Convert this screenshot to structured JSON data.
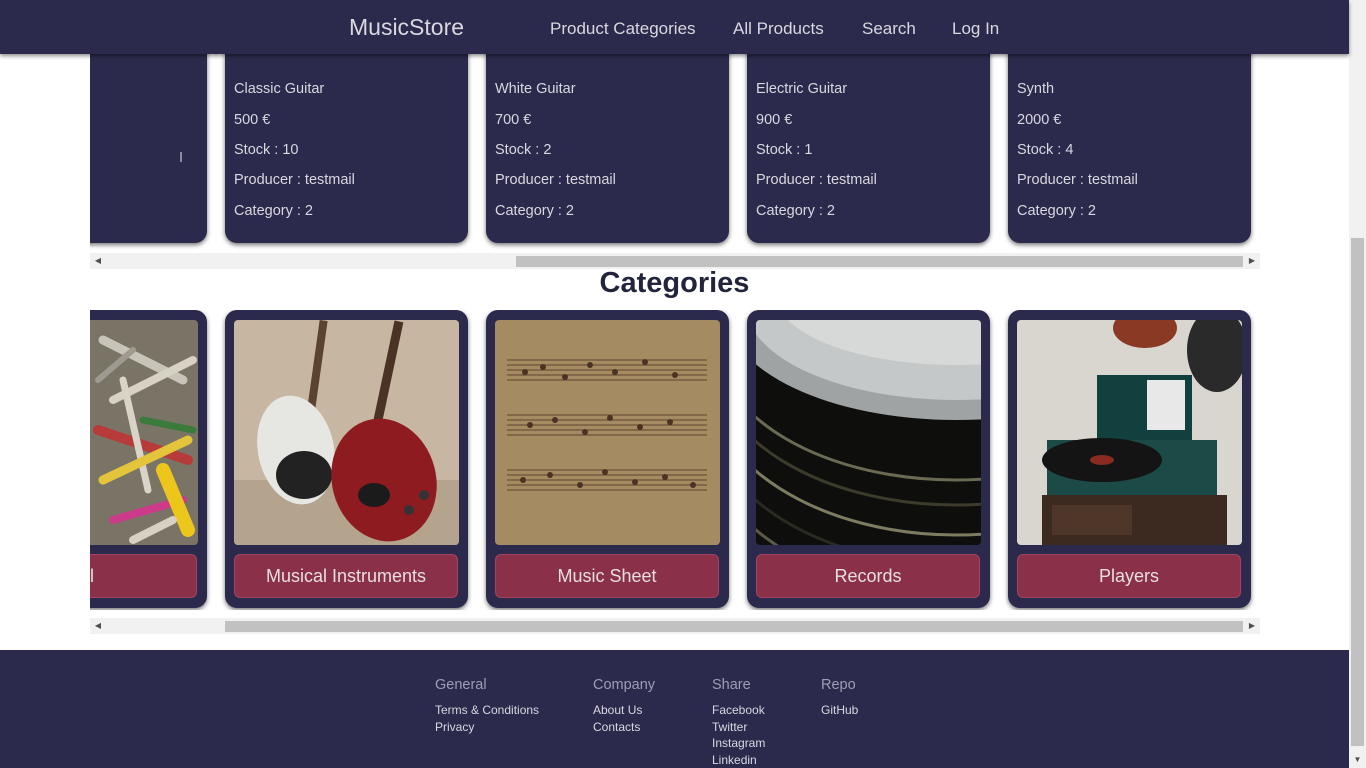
{
  "navbar": {
    "brand": "MusicStore",
    "links": [
      "Product Categories",
      "All Products",
      "Search",
      "Log In"
    ]
  },
  "products": [
    {
      "name": "Classic Guitar",
      "price": "500 €",
      "stock": "Stock : 10",
      "producer": "Producer : testmail",
      "category": "Category : 2"
    },
    {
      "name": "White Guitar",
      "price": "700 €",
      "stock": "Stock : 2",
      "producer": "Producer : testmail",
      "category": "Category : 2"
    },
    {
      "name": "Electric Guitar",
      "price": "900 €",
      "stock": "Stock : 1",
      "producer": "Producer : testmail",
      "category": "Category : 2"
    },
    {
      "name": "Synth",
      "price": "2000 €",
      "stock": "Stock : 4",
      "producer": "Producer : testmail",
      "category": "Category : 2"
    }
  ],
  "categories_title": "Categories",
  "categories": [
    {
      "label": "l",
      "image": "tools-image"
    },
    {
      "label": "Musical Instruments",
      "image": "guitars-image"
    },
    {
      "label": "Music Sheet",
      "image": "sheet-music-image"
    },
    {
      "label": "Records",
      "image": "vinyl-records-image"
    },
    {
      "label": "Players",
      "image": "record-player-image"
    }
  ],
  "footer": {
    "columns": [
      {
        "title": "General",
        "links": [
          "Terms & Conditions",
          "Privacy"
        ]
      },
      {
        "title": "Company",
        "links": [
          "About Us",
          "Contacts"
        ]
      },
      {
        "title": "Share",
        "links": [
          "Facebook",
          "Twitter",
          "Instagram",
          "Linkedin"
        ]
      },
      {
        "title": "Repo",
        "links": [
          "GitHub"
        ]
      }
    ]
  },
  "colors": {
    "navy": "#2b2a4c",
    "button": "#8b3049",
    "text_light": "#d8d8e0",
    "title": "#22243d"
  }
}
